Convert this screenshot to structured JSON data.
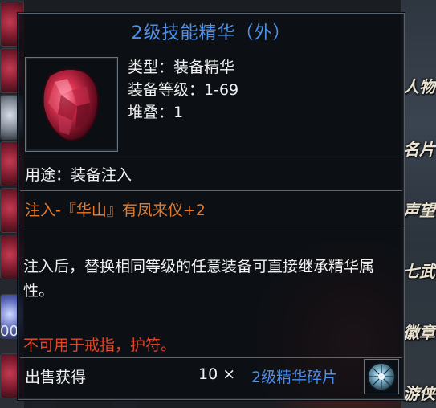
{
  "tooltip": {
    "title": "2级技能精华（外）",
    "info": [
      "类型：装备精华",
      "装备等级：1-69",
      "堆叠：1"
    ],
    "usage": "用途：装备注入",
    "effect": "注入-『华山』有凤来仪+2",
    "description": "注入后，替换相同等级的任意装备可直接继承精华属性。",
    "restriction": "不可用于戒指，护符。",
    "sell": {
      "label": "出售获得",
      "quantity": "10 ×",
      "item_name": "2级精华碎片"
    },
    "colors": {
      "title": "#4f8fe6",
      "effect": "#e37b2e",
      "restriction": "#e0462c",
      "sell_item": "#4f8fe6"
    },
    "item_icon": "red-essence-gem-icon",
    "fragment_icon": "essence-fragment-orb-icon"
  },
  "background": {
    "inventory_count": "00",
    "side_labels": [
      "人物",
      "名片",
      "声望",
      "七武",
      "徽章",
      "游侠"
    ]
  }
}
